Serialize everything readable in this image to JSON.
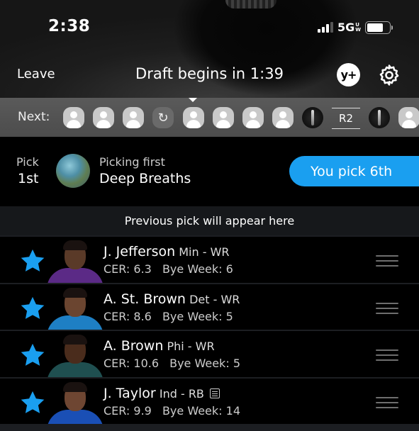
{
  "status_bar": {
    "time": "2:38",
    "network": "5G",
    "network_sup": "U",
    "network_sub": "W",
    "battery_level": 0.72
  },
  "header": {
    "leave_label": "Leave",
    "title": "Draft begins in 1:39",
    "yplus_label": "y+",
    "settings_icon": "gear-icon"
  },
  "next_bar": {
    "label": "Next:",
    "round_label": "R2",
    "slots": [
      {
        "type": "user"
      },
      {
        "type": "user"
      },
      {
        "type": "user"
      },
      {
        "type": "autodraft"
      },
      {
        "type": "user",
        "current": true
      },
      {
        "type": "user"
      },
      {
        "type": "user"
      },
      {
        "type": "user"
      },
      {
        "type": "team"
      },
      {
        "type": "round"
      },
      {
        "type": "team"
      },
      {
        "type": "user"
      }
    ]
  },
  "pick_info": {
    "pick_label": "Pick",
    "pick_value": "1st",
    "picking_label": "Picking first",
    "picking_team": "Deep Breaths",
    "you_pick": "You pick 6th"
  },
  "previous_pick": "Previous pick will appear here",
  "players": [
    {
      "name": "J. Jefferson",
      "team": "Min",
      "position": "WR",
      "cer_label": "CER:",
      "cer": "6.3",
      "bye_label": "Bye Week:",
      "bye": "6",
      "has_note": false,
      "jersey_color": "#5b2a86",
      "skin": "#5a3a28"
    },
    {
      "name": "A. St. Brown",
      "team": "Det",
      "position": "WR",
      "cer_label": "CER:",
      "cer": "8.6",
      "bye_label": "Bye Week:",
      "bye": "5",
      "has_note": false,
      "jersey_color": "#1e7fc4",
      "skin": "#6b4530"
    },
    {
      "name": "A. Brown",
      "team": "Phi",
      "position": "WR",
      "cer_label": "CER:",
      "cer": "10.6",
      "bye_label": "Bye Week:",
      "bye": "5",
      "has_note": false,
      "jersey_color": "#1f4f50",
      "skin": "#4a2c1c"
    },
    {
      "name": "J. Taylor",
      "team": "Ind",
      "position": "RB",
      "cer_label": "CER:",
      "cer": "9.9",
      "bye_label": "Bye Week:",
      "bye": "14",
      "has_note": true,
      "jersey_color": "#1a4fb5",
      "skin": "#6e4632"
    }
  ],
  "colors": {
    "accent": "#1a9ff0",
    "star": "#1a9ff0"
  }
}
